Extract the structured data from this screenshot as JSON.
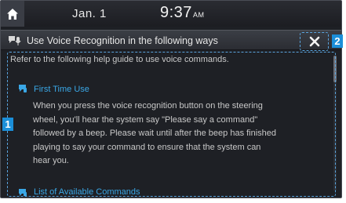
{
  "status_bar": {
    "date": "Jan.  1",
    "time": "9:37",
    "ampm": "AM"
  },
  "dialog": {
    "title": "Use Voice Recognition in the following ways",
    "intro": "Refer to the following help guide to use voice commands.",
    "sections": [
      {
        "heading": "First Time Use",
        "lines": [
          "When you press the voice recognition button on the steering",
          "wheel, you'll hear the system say \"Please say a command\"",
          "followed by a beep. Please wait until after the beep has finished",
          "playing to say your command to ensure that the system can",
          "hear you."
        ]
      },
      {
        "heading": "List of Available Commands"
      }
    ]
  },
  "callouts": [
    "1",
    "2"
  ],
  "icons": {
    "home": "home-icon",
    "title": "voice-recognition-icon",
    "close": "close-icon",
    "section": "voice-help-icon"
  },
  "colors": {
    "accent": "#3aa7e6",
    "callout": "#1b8fd9",
    "background": "#1e2025"
  }
}
